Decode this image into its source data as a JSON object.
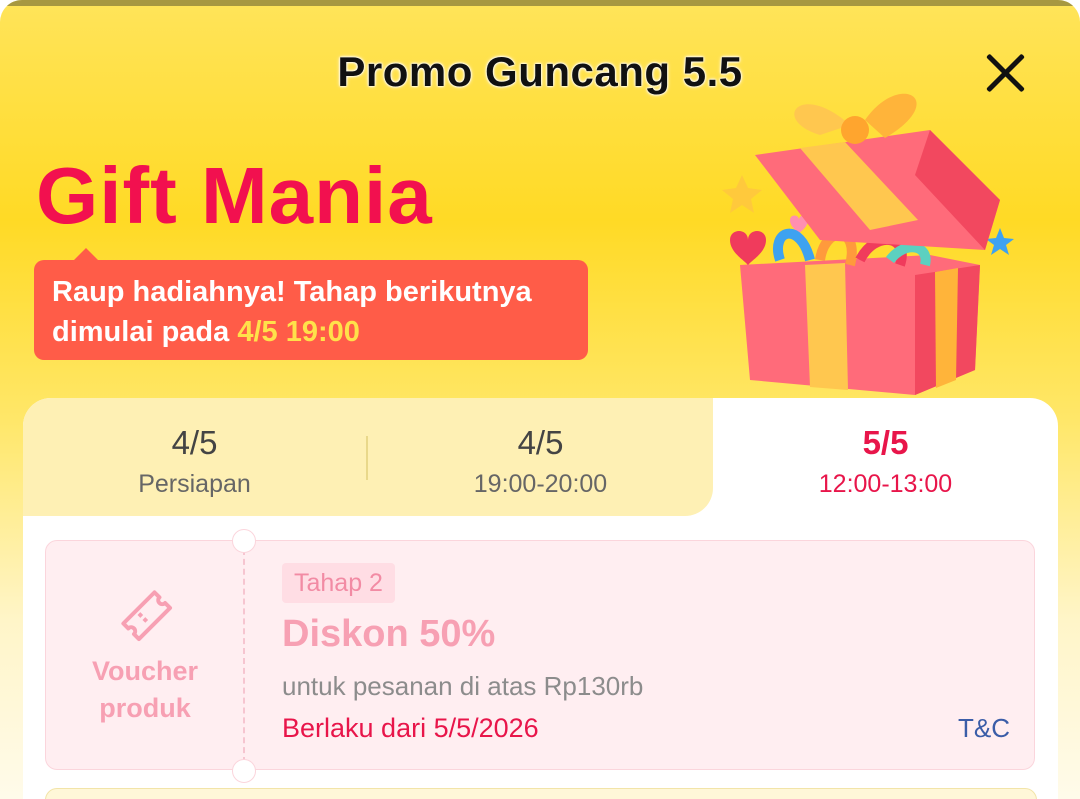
{
  "header": {
    "title": "Promo Guncang 5.5"
  },
  "banner": {
    "brand": "Gift Mania",
    "message_line1": "Raup hadiahnya! Tahap berikutnya",
    "message_line2_prefix": "dimulai pada",
    "message_highlight": "4/5 19:00"
  },
  "tabs": [
    {
      "date": "4/5",
      "time": "Persiapan"
    },
    {
      "date": "4/5",
      "time": "19:00-20:00"
    },
    {
      "date": "5/5",
      "time": "12:00-13:00"
    }
  ],
  "voucher": {
    "type_line1": "Voucher",
    "type_line2": "produk",
    "stage": "Tahap 2",
    "discount": "Diskon 50%",
    "condition": "untuk pesanan di atas Rp130rb",
    "validity": "Berlaku dari 5/5/2026",
    "tnc": "T&C"
  },
  "colors": {
    "accent": "#E8154A",
    "brand": "#F2104F",
    "bubble": "#FF5C48",
    "highlight": "#FFE14A"
  }
}
